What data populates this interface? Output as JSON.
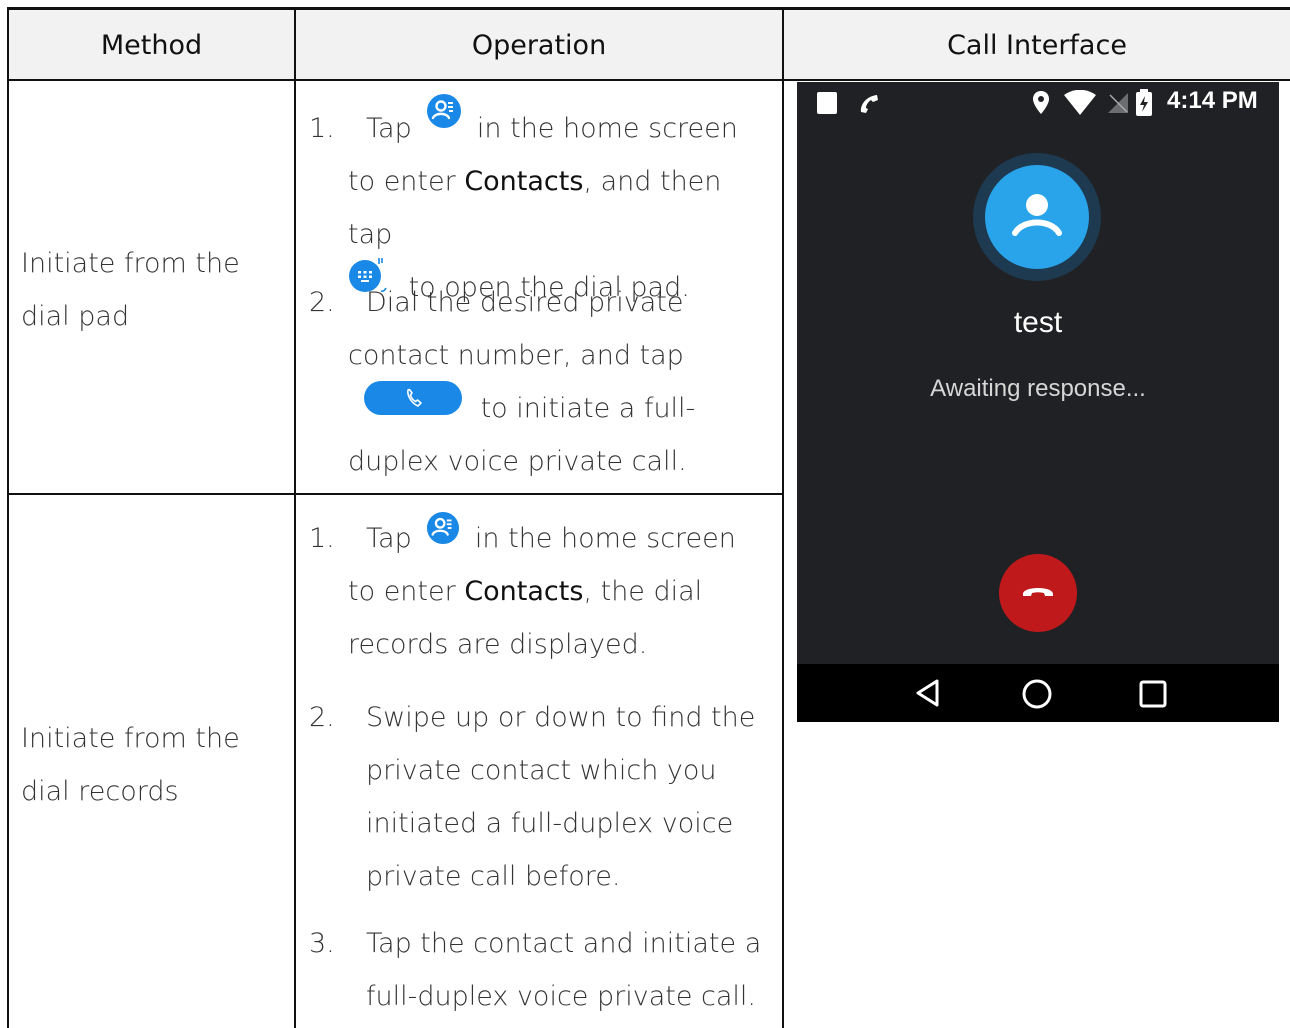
{
  "table": {
    "headers": {
      "method": "Method",
      "operation": "Operation",
      "call_interface": "Call Interface"
    },
    "row1": {
      "method": "Initiate from the dial pad",
      "step1": {
        "num": "1.",
        "a": "Tap",
        "b": "in the home screen to enter",
        "c": "Contacts",
        "d": ", and then tap",
        "e": "to open the dial pad."
      },
      "step2": {
        "num": "2.",
        "a": "Dial the desired private contact number, and tap",
        "b": "to initiate a full-duplex voice private call."
      }
    },
    "row2": {
      "method": "Initiate from the dial records",
      "step1": {
        "num": "1.",
        "a": "Tap",
        "b": "in the home screen to enter",
        "c": "Contacts",
        "d": ", the dial records are displayed."
      },
      "step2": {
        "num": "2.",
        "text": "Swipe up or down to find the private contact which you initiated a full-duplex voice private call before."
      },
      "step3": {
        "num": "3.",
        "text": "Tap the contact and initiate a full-duplex voice private call."
      }
    }
  },
  "phone": {
    "time": "4:14 PM",
    "contact_name": "test",
    "status": "Awaiting response..."
  },
  "icons": {
    "contacts": "contacts-app-icon",
    "dialpad": "dialpad-icon",
    "call_button": "call-button-icon"
  },
  "colors": {
    "accent_blue": "#1a88e6",
    "avatar_blue": "#29a3ea",
    "end_call_red": "#c0191c",
    "phone_bg": "#202124",
    "nav_bg": "#000000"
  }
}
